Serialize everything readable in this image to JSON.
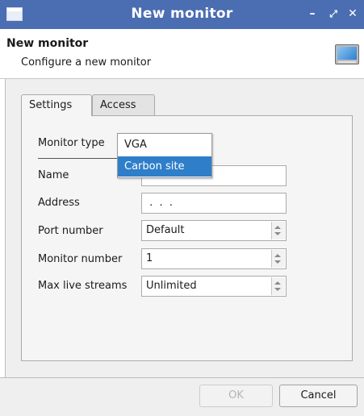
{
  "window": {
    "title": "New monitor",
    "minimize_glyph": "–",
    "maximize_glyph": "⤢",
    "close_glyph": "✕"
  },
  "header": {
    "title": "New monitor",
    "subtitle": "Configure a new monitor",
    "icon": "monitor-icon"
  },
  "tabs": [
    {
      "label": "Settings",
      "active": true
    },
    {
      "label": "Access",
      "active": false
    }
  ],
  "form": {
    "monitor_type_label": "Monitor type",
    "name_label": "Name",
    "name_value": "",
    "address_label": "Address",
    "address_value": " .  .  .",
    "port_label": "Port number",
    "port_value": "Default",
    "monitor_number_label": "Monitor number",
    "monitor_number_value": "1",
    "max_streams_label": "Max live streams",
    "max_streams_value": "Unlimited"
  },
  "monitor_type_dropdown": {
    "options": [
      {
        "label": "VGA",
        "selected": false
      },
      {
        "label": "Carbon site",
        "selected": true
      }
    ]
  },
  "footer": {
    "ok_label": "OK",
    "cancel_label": "Cancel"
  },
  "colors": {
    "titlebar": "#4b6db2",
    "selection": "#2e7ec9"
  }
}
